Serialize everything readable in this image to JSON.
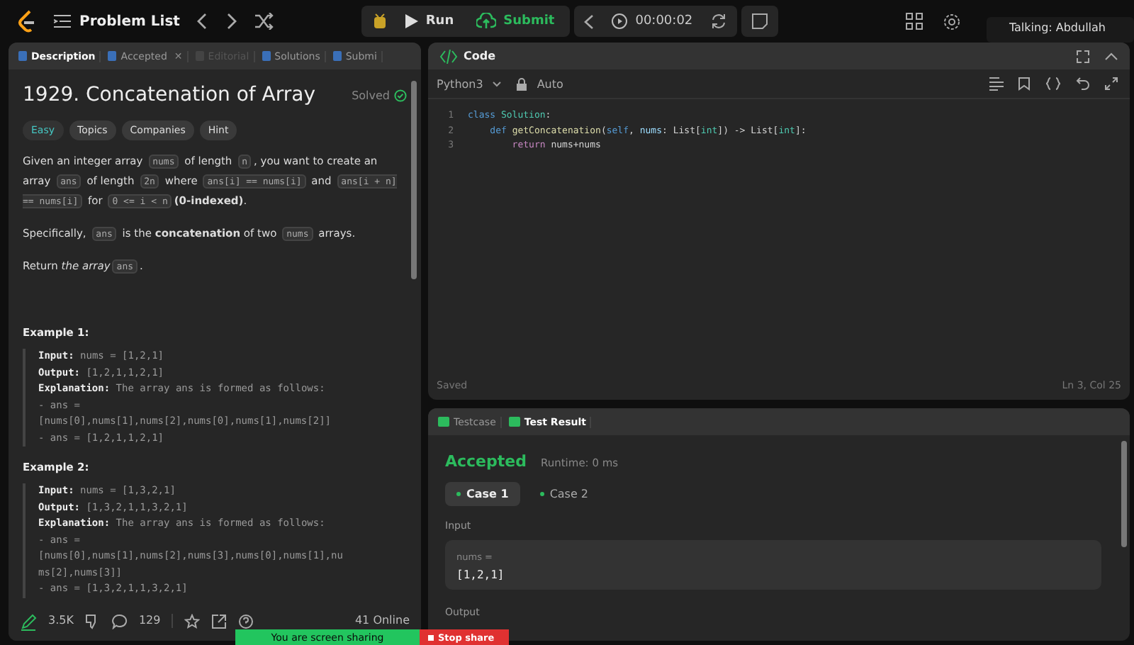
{
  "topbar": {
    "title": "Problem List",
    "run": "Run",
    "submit": "Submit",
    "timer": "00:00:02"
  },
  "talking": "Talking: Abdullah",
  "left_tabs": [
    {
      "label": "Description",
      "selected": true,
      "disabled": false
    },
    {
      "label": "Accepted",
      "selected": false,
      "disabled": false,
      "close": "✕"
    },
    {
      "label": "Editorial",
      "selected": false,
      "disabled": true
    },
    {
      "label": "Solutions",
      "selected": false,
      "disabled": false
    },
    {
      "label": "Submi",
      "selected": false,
      "disabled": false
    }
  ],
  "problem": {
    "title": "1929. Concatenation of Array",
    "status": "Solved",
    "difficulty": "Easy",
    "tags": [
      "Topics",
      "Companies",
      "Hint"
    ],
    "paragraphs": [
      [
        {
          "kind": "text",
          "t": "Given an integer array "
        },
        {
          "kind": "code",
          "t": "nums"
        },
        {
          "kind": "text",
          "t": " of length "
        },
        {
          "kind": "code",
          "t": "n"
        },
        {
          "kind": "text",
          "t": ", you want to create an array "
        },
        {
          "kind": "code",
          "t": "ans"
        },
        {
          "kind": "text",
          "t": " of length "
        },
        {
          "kind": "code",
          "t": "2n"
        },
        {
          "kind": "text",
          "t": " where "
        },
        {
          "kind": "code",
          "t": "ans[i] == nums[i]"
        },
        {
          "kind": "text",
          "t": " and "
        },
        {
          "kind": "code",
          "t": "ans[i + n] == nums[i]"
        },
        {
          "kind": "text",
          "t": " for "
        },
        {
          "kind": "code",
          "t": "0 <= i < n"
        },
        {
          "kind": "bold",
          "t": "(0-indexed)"
        },
        {
          "kind": "text",
          "t": "."
        }
      ],
      [
        {
          "kind": "text",
          "t": "Specifically, "
        },
        {
          "kind": "code",
          "t": "ans"
        },
        {
          "kind": "text",
          "t": " is the "
        },
        {
          "kind": "bold",
          "t": "concatenation"
        },
        {
          "kind": "text",
          "t": " of two "
        },
        {
          "kind": "code",
          "t": "nums"
        },
        {
          "kind": "text",
          "t": " arrays."
        }
      ],
      [
        {
          "kind": "text",
          "t": "Return "
        },
        {
          "kind": "italic",
          "t": "the array"
        },
        {
          "kind": "code",
          "t": "ans"
        },
        {
          "kind": "text",
          "t": "."
        }
      ]
    ],
    "examples": [
      {
        "title": "Example 1:",
        "lines": [
          {
            "label": "Input:",
            "value": "nums = [1,2,1]"
          },
          {
            "label": "Output:",
            "value": "[1,2,1,1,2,1]"
          },
          {
            "label": "Explanation:",
            "value": "The array ans is formed as follows:"
          },
          {
            "value": "- ans ="
          },
          {
            "value": "[nums[0],nums[1],nums[2],nums[0],nums[1],nums[2]]"
          },
          {
            "value": "- ans = [1,2,1,1,2,1]"
          }
        ]
      },
      {
        "title": "Example 2:",
        "lines": [
          {
            "label": "Input:",
            "value": "nums = [1,3,2,1]"
          },
          {
            "label": "Output:",
            "value": "[1,3,2,1,1,3,2,1]"
          },
          {
            "label": "Explanation:",
            "value": "The array ans is formed as follows:"
          },
          {
            "value": "- ans ="
          },
          {
            "value": "[nums[0],nums[1],nums[2],nums[3],nums[0],nums[1],nu"
          },
          {
            "value": "ms[2],nums[3]]"
          },
          {
            "value": "- ans = [1,3,2,1,1,3,2,1]"
          }
        ]
      }
    ]
  },
  "footer": {
    "likes": "3.5K",
    "comments": "129",
    "online": "41 Online"
  },
  "code": {
    "title": "Code",
    "language": "Python3",
    "mode": "Auto",
    "saved": "Saved",
    "position": "Ln 3, Col 25",
    "lines": [
      {
        "num": "1",
        "tokens": [
          {
            "kind": "kw",
            "t": "class "
          },
          {
            "kind": "cls",
            "t": "Solution"
          },
          {
            "kind": "plain",
            "t": ":"
          }
        ]
      },
      {
        "num": "2",
        "tokens": [
          {
            "kind": "kw",
            "t": "    def "
          },
          {
            "kind": "fn",
            "t": "getConcatenation"
          },
          {
            "kind": "plain",
            "t": "("
          },
          {
            "kind": "kw",
            "t": "self"
          },
          {
            "kind": "plain",
            "t": ", "
          },
          {
            "kind": "var",
            "t": "nums"
          },
          {
            "kind": "plain",
            "t": ": List["
          },
          {
            "kind": "cls",
            "t": "int"
          },
          {
            "kind": "plain",
            "t": "]) -> List["
          },
          {
            "kind": "cls",
            "t": "int"
          },
          {
            "kind": "plain",
            "t": "]:"
          }
        ]
      },
      {
        "num": "3",
        "tokens": [
          {
            "kind": "ret",
            "t": "        return "
          },
          {
            "kind": "plain",
            "t": "nums+nums"
          }
        ]
      }
    ]
  },
  "result_tabs": [
    {
      "label": "Testcase",
      "selected": false
    },
    {
      "label": "Test Result",
      "selected": true
    }
  ],
  "result": {
    "verdict": "Accepted",
    "runtime": "Runtime: 0 ms",
    "cases": [
      {
        "label": "Case 1",
        "selected": true
      },
      {
        "label": "Case 2",
        "selected": false
      }
    ],
    "input_label": "Input",
    "param": "nums =",
    "value": "[1,2,1]",
    "output_label": "Output"
  },
  "share": {
    "message": "You are screen sharing",
    "stop": "Stop share"
  }
}
